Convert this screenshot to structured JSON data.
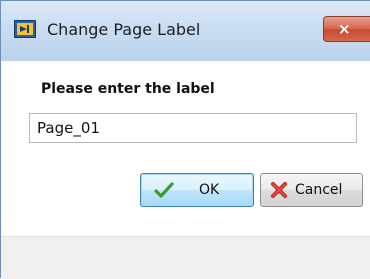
{
  "window": {
    "title": "Change Page Label",
    "close_symbol": "×",
    "app_icon": "page-label-icon",
    "close_icon": "close-icon"
  },
  "dialog": {
    "prompt": "Please enter the label",
    "input_value": "Page_01"
  },
  "buttons": {
    "ok_label": "OK",
    "ok_icon": "checkmark-icon",
    "cancel_label": "Cancel",
    "cancel_icon": "red-x-icon"
  },
  "colors": {
    "titlebar": "#c9ddf2",
    "close_button": "#d46a4e",
    "ok_button_border": "#3c7fb1",
    "footer": "#f0f0f0"
  }
}
